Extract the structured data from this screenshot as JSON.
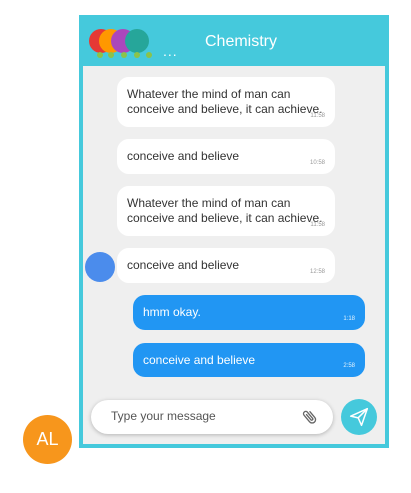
{
  "header": {
    "title": "Chemistry",
    "more_indicator": "...",
    "participants": [
      {
        "color": "#e53935"
      },
      {
        "color": "#ff9800"
      },
      {
        "color": "#ab47bc"
      },
      {
        "color": "#26a69a"
      }
    ],
    "status_dots": [
      "#8bc34a",
      "#8bc34a",
      "#8bc34a",
      "#8bc34a",
      "#8bc34a"
    ]
  },
  "messages": [
    {
      "direction": "in",
      "text": "Whatever the mind of man can conceive and believe, it can achieve.",
      "time": "11:58"
    },
    {
      "direction": "in",
      "text": "conceive and believe",
      "time": "10:58"
    },
    {
      "direction": "in",
      "text": "Whatever the mind of man can conceive and believe, it can achieve.",
      "time": "11:58"
    },
    {
      "direction": "in",
      "text": "conceive and believe",
      "time": "12:58",
      "has_avatar": true
    },
    {
      "direction": "out",
      "text": "hmm okay.",
      "time": "1:18"
    },
    {
      "direction": "out",
      "text": "conceive and believe",
      "time": "2:58"
    }
  ],
  "input": {
    "placeholder": "Type your message",
    "attach_icon": "paperclip-icon"
  },
  "send": {
    "icon": "send-icon"
  },
  "user": {
    "initials": "AL",
    "color": "#f7961c"
  },
  "colors": {
    "accent": "#45c9dc",
    "outgoing": "#2196f3",
    "background": "#efefef"
  }
}
